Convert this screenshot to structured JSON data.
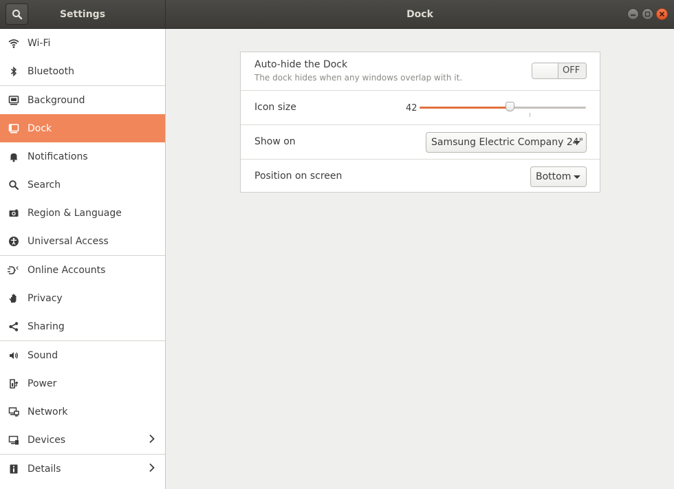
{
  "header": {
    "sidebar_title": "Settings",
    "page_title": "Dock"
  },
  "sidebar": {
    "items": [
      {
        "label": "Wi-Fi",
        "icon": "wifi-icon"
      },
      {
        "label": "Bluetooth",
        "icon": "bluetooth-icon"
      },
      {
        "label": "Background",
        "icon": "background-icon"
      },
      {
        "label": "Dock",
        "icon": "dock-icon",
        "active": true
      },
      {
        "label": "Notifications",
        "icon": "bell-icon"
      },
      {
        "label": "Search",
        "icon": "search-icon"
      },
      {
        "label": "Region & Language",
        "icon": "camera-icon"
      },
      {
        "label": "Universal Access",
        "icon": "accessibility-icon"
      },
      {
        "label": "Online Accounts",
        "icon": "online-accounts-icon"
      },
      {
        "label": "Privacy",
        "icon": "hand-icon"
      },
      {
        "label": "Sharing",
        "icon": "share-icon"
      },
      {
        "label": "Sound",
        "icon": "speaker-icon"
      },
      {
        "label": "Power",
        "icon": "power-plug-icon"
      },
      {
        "label": "Network",
        "icon": "network-icon"
      },
      {
        "label": "Devices",
        "icon": "devices-icon",
        "has_submenu": true
      },
      {
        "label": "Details",
        "icon": "info-icon",
        "has_submenu": true
      }
    ]
  },
  "dock": {
    "autohide": {
      "label": "Auto-hide the Dock",
      "description": "The dock hides when any windows overlap with it.",
      "state": "OFF"
    },
    "icon_size": {
      "label": "Icon size",
      "value": "42",
      "fraction": 0.54
    },
    "show_on": {
      "label": "Show on",
      "selected": "Samsung Electric Company 24\""
    },
    "position": {
      "label": "Position on screen",
      "selected": "Bottom"
    }
  },
  "colors": {
    "accent": "#f0865a",
    "slider_fill": "#e0703f",
    "close_button": "#e95420",
    "headerbar": "#3c3b37"
  }
}
